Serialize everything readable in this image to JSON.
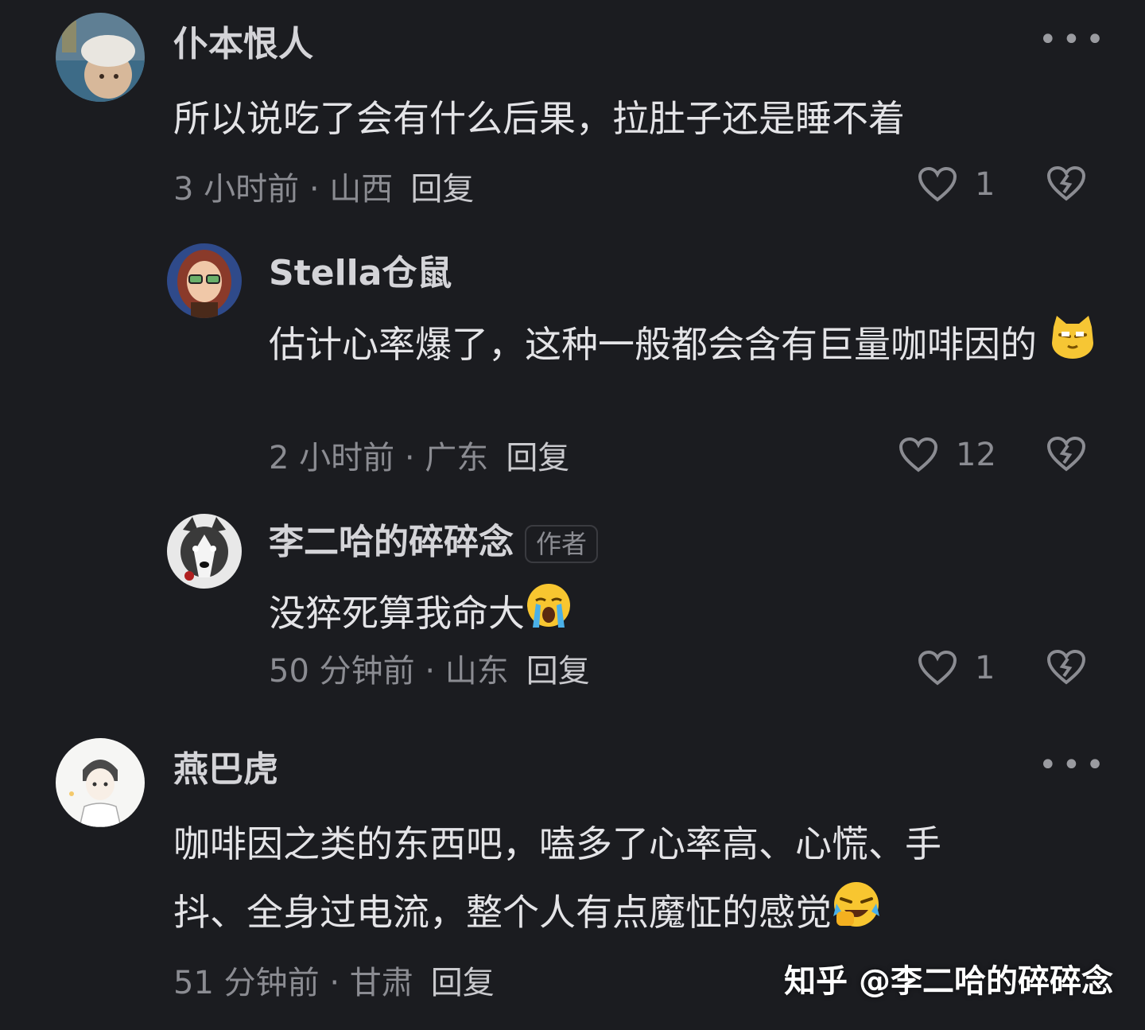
{
  "comments": [
    {
      "name": "仆本恨人",
      "content": "所以说吃了会有什么后果，拉肚子还是睡不着",
      "time": "3 小时前 · 山西",
      "reply": "回复",
      "likes": "1"
    },
    {
      "name": "Stella仓鼠",
      "content": "估计心率爆了，这种一般都会含有巨量咖啡因的",
      "time": "2 小时前 · 广东",
      "reply": "回复",
      "likes": "12"
    },
    {
      "name": "李二哈的碎碎念",
      "badge": "作者",
      "content": "没猝死算我命大",
      "time": "50 分钟前 · 山东",
      "reply": "回复",
      "likes": "1"
    },
    {
      "name": "燕巴虎",
      "content_line1": "咖啡因之类的东西吧，嗑多了心率高、心慌、手",
      "content_line2": "抖、全身过电流，整个人有点魔怔的感觉",
      "time": "51 分钟前 · 甘肃",
      "reply": "回复"
    }
  ],
  "watermark": "知乎 @李二哈的碎碎念",
  "icons": {
    "like": "heart-icon",
    "dislike": "broken-heart-icon",
    "more": "more-dots-icon"
  },
  "colors": {
    "background": "#1b1c20",
    "meta": "#8b8c92"
  }
}
